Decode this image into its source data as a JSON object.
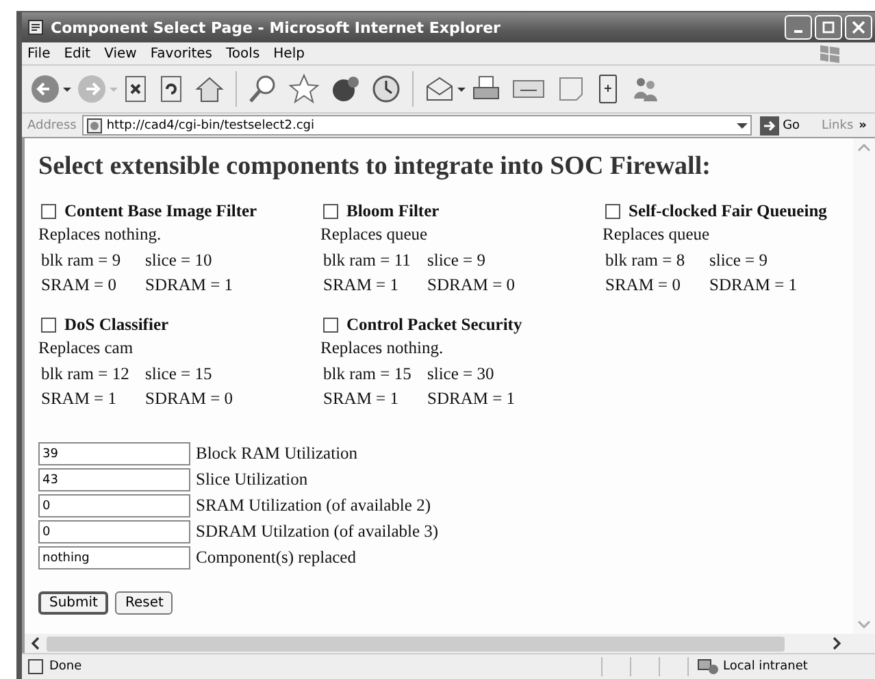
{
  "window": {
    "title": "Component Select Page - Microsoft Internet Explorer"
  },
  "menu": [
    "File",
    "Edit",
    "View",
    "Favorites",
    "Tools",
    "Help"
  ],
  "address": {
    "label": "Address",
    "url": "http://cad4/cgi-bin/testselect2.cgi",
    "go": "Go",
    "links": "Links",
    "more": "»"
  },
  "heading": "Select extensible components to integrate into SOC Firewall:",
  "components": [
    {
      "name": "Content Base Image Filter",
      "checked": false,
      "replaces": "Replaces nothing.",
      "blk_ram": "blk ram = 9",
      "slice": "slice = 10",
      "sram": "SRAM = 0",
      "sdram": "SDRAM = 1"
    },
    {
      "name": "Bloom Filter",
      "checked": false,
      "replaces": "Replaces queue",
      "blk_ram": "blk ram = 11",
      "slice": "slice = 9",
      "sram": "SRAM = 1",
      "sdram": "SDRAM = 0"
    },
    {
      "name": "Self-clocked Fair Queueing",
      "checked": false,
      "replaces": "Replaces queue",
      "blk_ram": "blk ram = 8",
      "slice": "slice = 9",
      "sram": "SRAM = 0",
      "sdram": "SDRAM = 1"
    },
    {
      "name": "DoS Classifier",
      "checked": false,
      "replaces": "Replaces cam",
      "blk_ram": "blk ram = 12",
      "slice": "slice = 15",
      "sram": "SRAM = 1",
      "sdram": "SDRAM = 0"
    },
    {
      "name": "Control Packet Security",
      "checked": false,
      "replaces": "Replaces nothing.",
      "blk_ram": "blk ram = 15",
      "slice": "slice = 30",
      "sram": "SRAM = 1",
      "sdram": "SDRAM = 1"
    }
  ],
  "fields": [
    {
      "value": "39",
      "label": "Block RAM Utilization"
    },
    {
      "value": "43",
      "label": "Slice Utilization"
    },
    {
      "value": "0",
      "label": "SRAM Utilization (of available 2)"
    },
    {
      "value": "0",
      "label": "SDRAM Utilzation (of available 3)"
    },
    {
      "value": "nothing",
      "label": "Component(s) replaced"
    }
  ],
  "buttons": [
    "Submit",
    "Reset"
  ],
  "status_bar": {
    "text": "Done",
    "zone": "Local intranet"
  }
}
